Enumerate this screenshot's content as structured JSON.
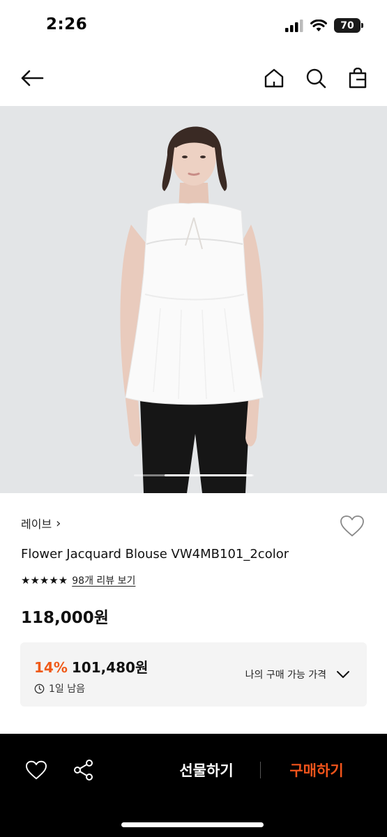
{
  "status": {
    "time": "2:26",
    "battery": "70"
  },
  "product": {
    "brand": "레이브",
    "brand_chevron": "›",
    "name": "Flower Jacquard Blouse VW4MB101_2color",
    "stars": "★★★★★",
    "rating_stars": 5,
    "review_link": "98개 리뷰 보기",
    "price": "118,000원",
    "image_count_position": 0.33
  },
  "discount": {
    "percent": "14%",
    "price": "101,480원",
    "remaining": "1일 남음",
    "my_price_label": "나의 구매 가능 가격"
  },
  "bottom": {
    "gift_label": "선물하기",
    "buy_label": "구매하기"
  },
  "colors": {
    "accent": "#ef5a19",
    "buy": "#f2541b",
    "bottom_bar": "#000000"
  },
  "icons": [
    "back-arrow-icon",
    "home-icon",
    "search-icon",
    "shopping-bag-icon",
    "heart-icon",
    "star-icon",
    "clock-icon",
    "chevron-down-icon",
    "share-icon"
  ]
}
